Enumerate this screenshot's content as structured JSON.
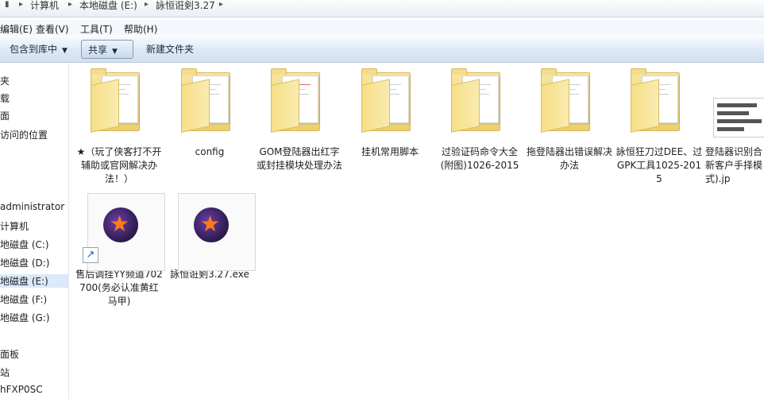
{
  "address": {
    "crumbs": [
      "计算机",
      "本地磁盘 (E:)",
      "詠恒诳剣3.27"
    ]
  },
  "menu": [
    "编辑(E)",
    "查看(V)",
    "工具(T)",
    "帮助(H)"
  ],
  "toolbar": {
    "library": "包含到库中",
    "share": "共享",
    "new_folder": "新建文件夹"
  },
  "nav": [
    "夹",
    "载",
    "面",
    "访问的位置",
    "administrator",
    "计算机",
    "地磁盘 (C:)",
    "地磁盘 (D:)",
    "地磁盘 (E:)",
    "地磁盘 (F:)",
    "地磁盘 (G:)",
    "面板",
    "站",
    "hFXP0SC"
  ],
  "items": [
    {
      "label": "★（玩了侠客打不开辅助或官网解决办法！）",
      "kind": "folder-doc"
    },
    {
      "label": "config",
      "kind": "folder"
    },
    {
      "label": "GOM登陆器出红字或封挂模块处理办法",
      "kind": "folder-doc"
    },
    {
      "label": "挂机常用脚本",
      "kind": "folder"
    },
    {
      "label": "过验证码命令大全(附图)1026-2015",
      "kind": "folder"
    },
    {
      "label": "拖登陆器出错误解决办法",
      "kind": "folder"
    },
    {
      "label": "詠恒狂刀过DEE、过GPK工具1025-2015",
      "kind": "folder"
    },
    {
      "label": "登陆器识别合新客户手择模式).jp",
      "kind": "jpg"
    },
    {
      "label": "售后调挂YY频道702700(务必认准黄红马甲)",
      "kind": "shortcut"
    },
    {
      "label": "詠恒诳剣3.27.exe",
      "kind": "exe"
    }
  ]
}
